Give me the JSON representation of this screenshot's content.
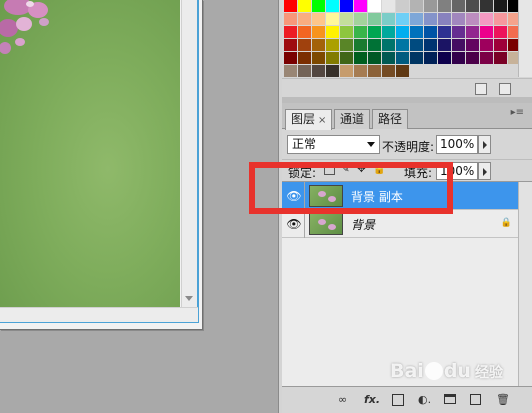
{
  "layers_panel": {
    "tabs": [
      {
        "label": "图层",
        "close": "×"
      },
      {
        "label": "通道"
      },
      {
        "label": "路径"
      }
    ],
    "blend_mode": "正常",
    "opacity_label": "不透明度:",
    "opacity_value": "100%",
    "lock_label": "锁定:",
    "fill_label": "填充:",
    "fill_value": "100%",
    "layers": [
      {
        "name": "背景 副本",
        "selected": true,
        "visible": true,
        "locked": false
      },
      {
        "name": "背景",
        "selected": false,
        "visible": true,
        "locked": true
      }
    ],
    "footer_icons": [
      "link-icon",
      "fx-icon",
      "mask-icon",
      "adjustment-icon",
      "group-icon",
      "new-layer-icon",
      "trash-icon"
    ]
  },
  "swatches": {
    "colors": [
      "#ff0000",
      "#ffff00",
      "#00ff00",
      "#00ffff",
      "#0000ff",
      "#ff00ff",
      "#ffffff",
      "#e6e6e6",
      "#cccccc",
      "#b3b3b3",
      "#999999",
      "#808080",
      "#666666",
      "#4d4d4d",
      "#333333",
      "#1a1a1a",
      "#000000",
      "#f7977a",
      "#f9ad81",
      "#fdc68a",
      "#fff79a",
      "#c4df9b",
      "#a3d39c",
      "#82ca9d",
      "#7bcdc8",
      "#6ecff6",
      "#7ea7d8",
      "#8493ca",
      "#8882be",
      "#a187be",
      "#bc8dbf",
      "#f49ac2",
      "#f6989d",
      "#f5a38c",
      "#ed1c24",
      "#f26522",
      "#f7941d",
      "#fff200",
      "#8dc63f",
      "#39b54a",
      "#00a651",
      "#00a99d",
      "#00aeef",
      "#0072bc",
      "#0054a6",
      "#2e3192",
      "#662d91",
      "#92278f",
      "#ec008c",
      "#ed145b",
      "#f26c4f",
      "#9e0b0f",
      "#a0410d",
      "#a36209",
      "#aba000",
      "#598527",
      "#1a7b30",
      "#007236",
      "#00746b",
      "#0076a3",
      "#004b80",
      "#003471",
      "#1b1464",
      "#440e62",
      "#630460",
      "#9e005d",
      "#9e0039",
      "#790000",
      "#790000",
      "#7b2e00",
      "#7d4900",
      "#827b00",
      "#406618",
      "#005e20",
      "#005826",
      "#005952",
      "#005b7f",
      "#003663",
      "#002157",
      "#0d004c",
      "#32004b",
      "#4b0049",
      "#7b0046",
      "#7a0026",
      "#c7b299",
      "#998675",
      "#736357",
      "#534741",
      "#37302a",
      "#c69c6d",
      "#a67c52",
      "#8c6239",
      "#754c24",
      "#603913"
    ]
  }
}
